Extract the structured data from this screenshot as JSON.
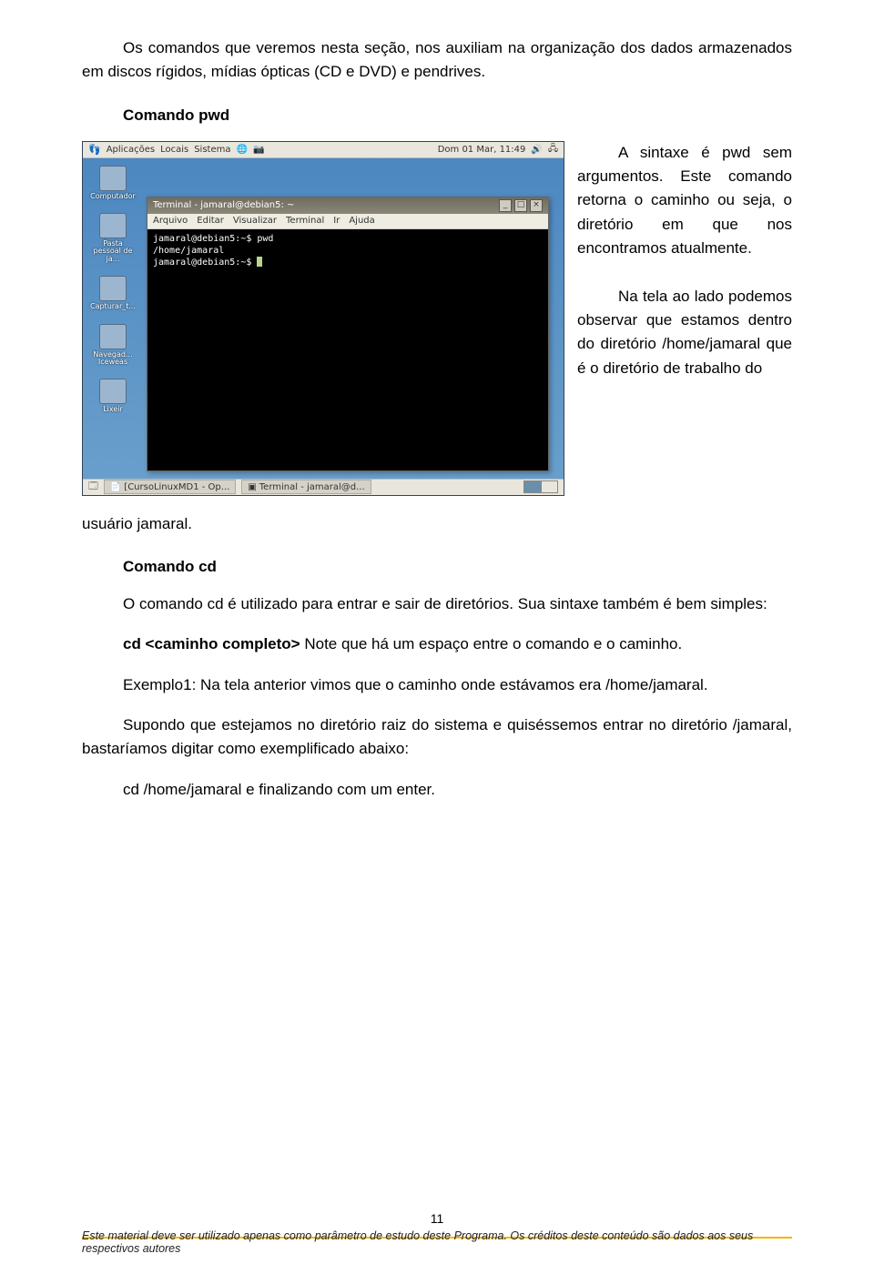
{
  "intro": "Os comandos que veremos nesta seção, nos auxiliam na organização dos dados armazenados em discos rígidos, mídias ópticas (CD e DVD) e pendrives.",
  "section_pwd_heading": "Comando  pwd",
  "pwd_side": {
    "p1a": "A sintaxe é pwd",
    "p1b": "sem argumentos. Este comando retorna o caminho ou seja, o diretório em que nos encontramos atualmente.",
    "p2": "Na tela ao lado podemos observar que estamos dentro do diretório /home/jamaral que é o diretório de trabalho do"
  },
  "pwd_after": "usuário jamaral.",
  "section_cd_heading": "Comando cd",
  "cd_p1": "O comando cd é utilizado para entrar e sair de diretórios. Sua sintaxe também é bem simples:",
  "cd_syntax_cmd": "cd   <caminho completo>",
  "cd_syntax_rest": " Note que há um espaço entre o comando e o caminho.",
  "cd_ex1": "Exemplo1: Na tela anterior vimos que o caminho onde estávamos era /home/jamaral.",
  "cd_ex2": "Supondo que estejamos no diretório raiz do sistema e quiséssemos entrar no diretório /jamaral, bastaríamos digitar como exemplificado abaixo:",
  "cd_final": "cd   /home/jamaral e finalizando com um enter.",
  "screenshot": {
    "panel_menus": [
      "Aplicações",
      "Locais",
      "Sistema"
    ],
    "clock": "Dom 01 Mar, 11:49",
    "desktop_icons": [
      "Computador",
      "Pasta pessoal de ja...",
      "Capturar_t...",
      "Navegad... Iceweas",
      "Lixeir"
    ],
    "taskbar": [
      "[CursoLinuxMD1 - Op...",
      "Terminal - jamaral@d..."
    ],
    "term_title": "Terminal - jamaral@debian5: ~",
    "term_menus": [
      "Arquivo",
      "Editar",
      "Visualizar",
      "Terminal",
      "Ir",
      "Ajuda"
    ],
    "term_lines": [
      "jamaral@debian5:~$ pwd",
      "/home/jamaral",
      "jamaral@debian5:~$ "
    ]
  },
  "page_number": "11",
  "footer_note": "Este material deve ser utilizado apenas como parâmetro de estudo deste Programa. Os créditos deste conteúdo são dados aos seus respectivos autores"
}
